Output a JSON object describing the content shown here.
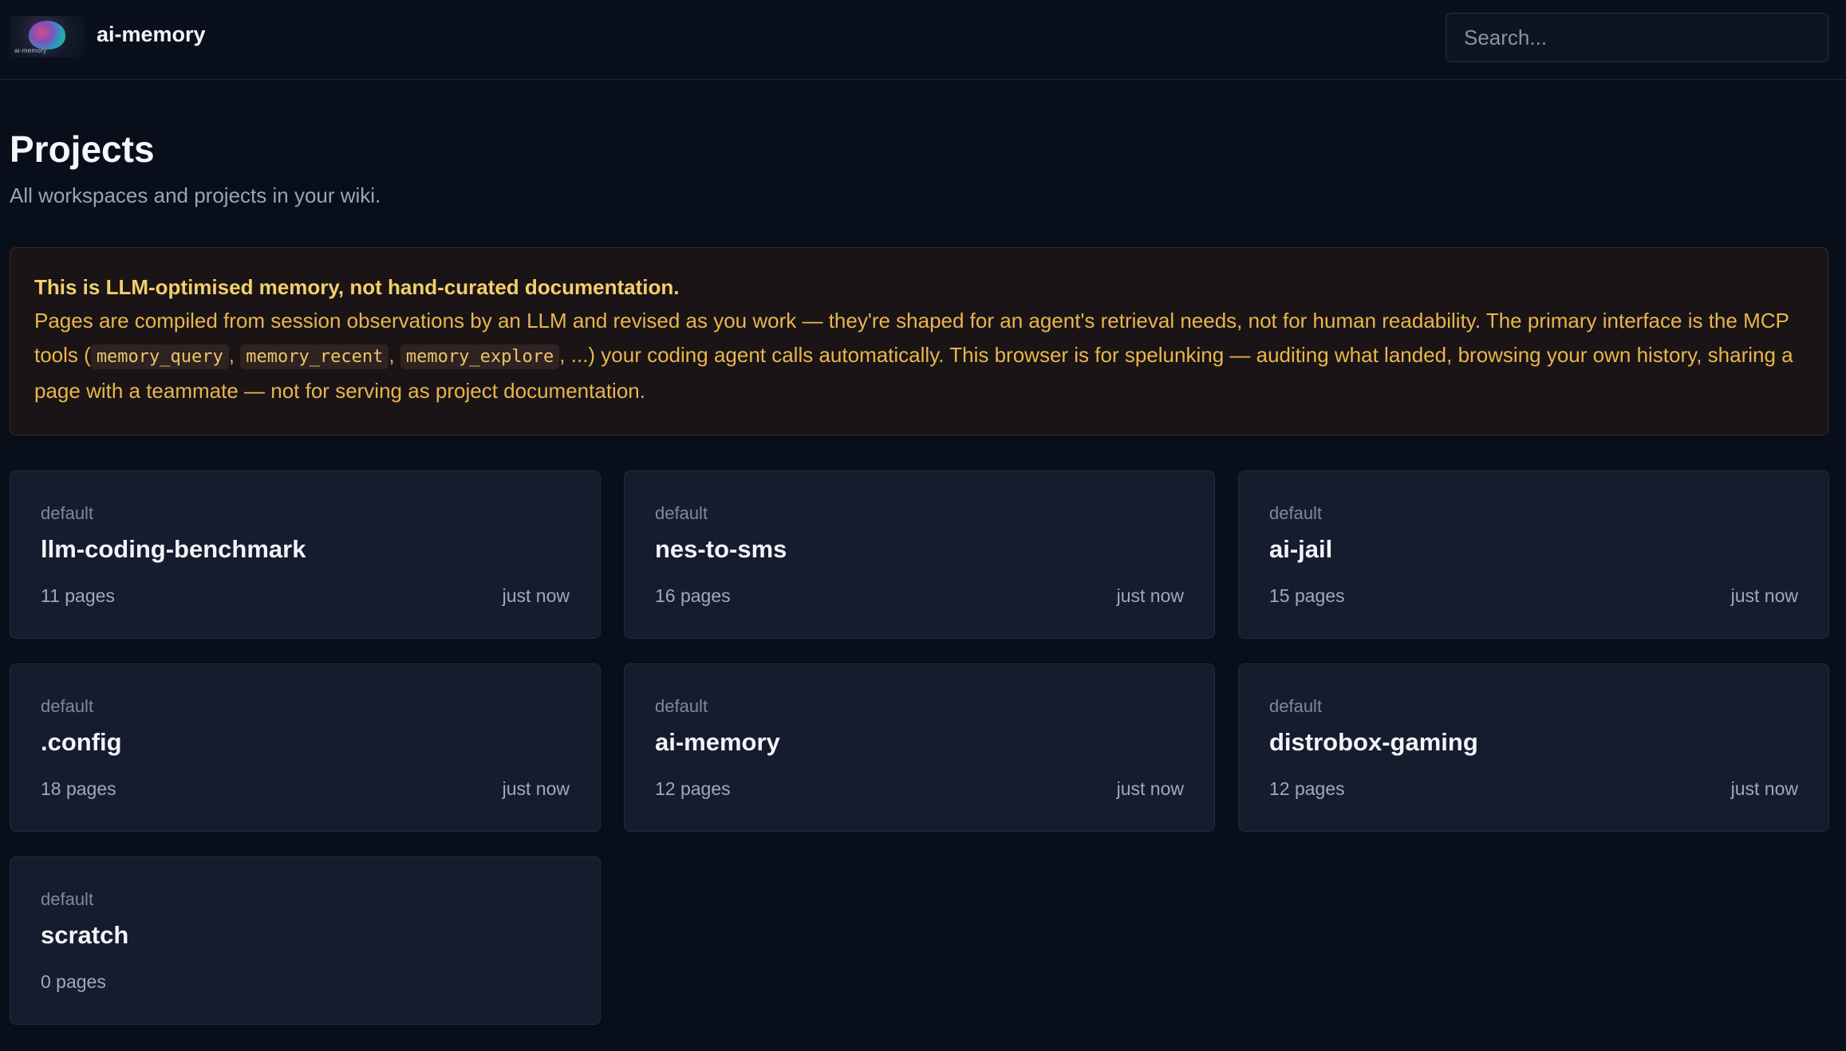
{
  "header": {
    "logo_text": "ai-memory",
    "brand": "ai-memory",
    "search_placeholder": "Search..."
  },
  "page": {
    "title": "Projects",
    "subtitle": "All workspaces and projects in your wiki."
  },
  "notice": {
    "title": "This is LLM-optimised memory, not hand-curated documentation.",
    "body_1": "Pages are compiled from session observations by an LLM and revised as you work — they're shaped for an agent's retrieval needs, not for human readability. The primary interface is the MCP tools (",
    "tool_1": "memory_query",
    "sep_1": ", ",
    "tool_2": "memory_recent",
    "sep_2": ", ",
    "tool_3": "memory_explore",
    "body_2": ", ...) your coding agent calls automatically. This browser is for spelunking — auditing what landed, browsing your own history, sharing a page with a teammate — not for serving as project documentation."
  },
  "projects": [
    {
      "workspace": "default",
      "name": "llm-coding-benchmark",
      "pages": "11 pages",
      "updated": "just now"
    },
    {
      "workspace": "default",
      "name": "nes-to-sms",
      "pages": "16 pages",
      "updated": "just now"
    },
    {
      "workspace": "default",
      "name": "ai-jail",
      "pages": "15 pages",
      "updated": "just now"
    },
    {
      "workspace": "default",
      "name": ".config",
      "pages": "18 pages",
      "updated": "just now"
    },
    {
      "workspace": "default",
      "name": "ai-memory",
      "pages": "12 pages",
      "updated": "just now"
    },
    {
      "workspace": "default",
      "name": "distrobox-gaming",
      "pages": "12 pages",
      "updated": "just now"
    },
    {
      "workspace": "default",
      "name": "scratch",
      "pages": "0 pages",
      "updated": ""
    }
  ]
}
